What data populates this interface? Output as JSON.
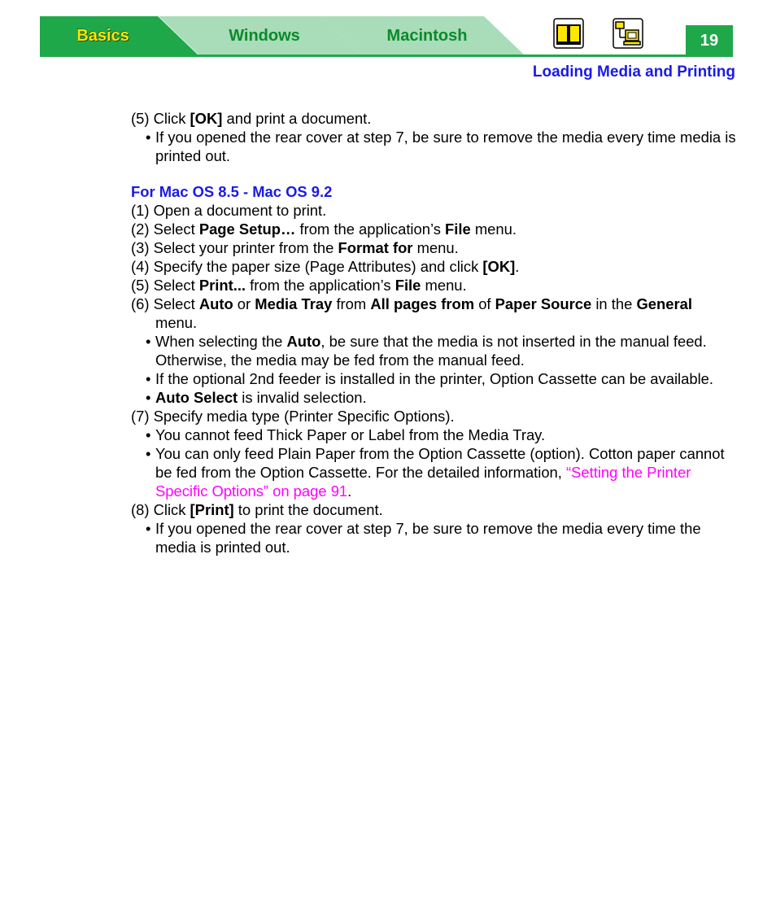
{
  "nav": {
    "tabs": [
      {
        "label": "Basics",
        "active": true
      },
      {
        "label": "Windows",
        "active": false
      },
      {
        "label": "Macintosh",
        "active": false
      }
    ],
    "icons": [
      "book-icon",
      "network-printer-icon"
    ],
    "page_number": "19",
    "section_title": "Loading Media and Printing"
  },
  "colors": {
    "accent_green": "#1fa84a",
    "tab_inactive": "#a9dcb9",
    "heading_blue": "#1a1ae6",
    "link_magenta": "#ff00ff",
    "active_tab_text": "#ffe800"
  },
  "content": {
    "step5_prev": {
      "pre": "(5) Click ",
      "bold": "[OK]",
      "post": " and print a document.",
      "bullet": "If you opened the rear cover at step 7, be sure to remove the media every time media is printed out."
    },
    "subheading": "For Mac OS 8.5 - Mac OS 9.2",
    "steps": {
      "s1": "(1) Open a document to print.",
      "s2": {
        "a": "(2) Select ",
        "b1": "Page Setup…",
        "c": " from the application’s ",
        "b2": "File",
        "d": " menu."
      },
      "s3": {
        "a": "(3) Select your printer from the ",
        "b1": "Format for",
        "c": " menu."
      },
      "s4": {
        "a": "(4) Specify the paper size (Page Attributes) and click ",
        "b1": "[OK]",
        "c": "."
      },
      "s5": {
        "a": "(5) Select ",
        "b1": "Print...",
        "c": " from the application’s ",
        "b2": "File",
        "d": " menu."
      },
      "s6": {
        "a": "(6) Select ",
        "b1": "Auto",
        "c": " or ",
        "b2": "Media Tray",
        "d": " from ",
        "b3": "All pages from",
        "e": " of ",
        "b4": "Paper Source",
        "f": " in the ",
        "b5": "General",
        "g": " menu."
      },
      "s6_bullets": {
        "b1": {
          "a": "When selecting the ",
          "bold": "Auto",
          "c": ", be sure that the media is not inserted in the manual feed. Otherwise, the media may be fed from the manual feed."
        },
        "b2": "If the optional 2nd feeder is installed in the printer, Option Cassette can be available.",
        "b3": {
          "bold": "Auto Select",
          "c": " is invalid selection."
        }
      },
      "s7": "(7) Specify media type (Printer Specific Options).",
      "s7_bullets": {
        "b1": "You cannot feed Thick Paper or Label from the Media Tray.",
        "b2": {
          "a": "You can only feed Plain Paper from the Option Cassette (option). Cotton paper cannot be fed from the Option Cassette. For the detailed information, ",
          "link": "“Setting the Printer Specific Options” on page 91",
          "c": "."
        }
      },
      "s8": {
        "a": "(8) Click ",
        "b1": "[Print]",
        "c": " to print the document."
      },
      "s8_bullet": "If you opened the rear cover at step 7, be sure to remove the media every time the media is printed out."
    }
  }
}
